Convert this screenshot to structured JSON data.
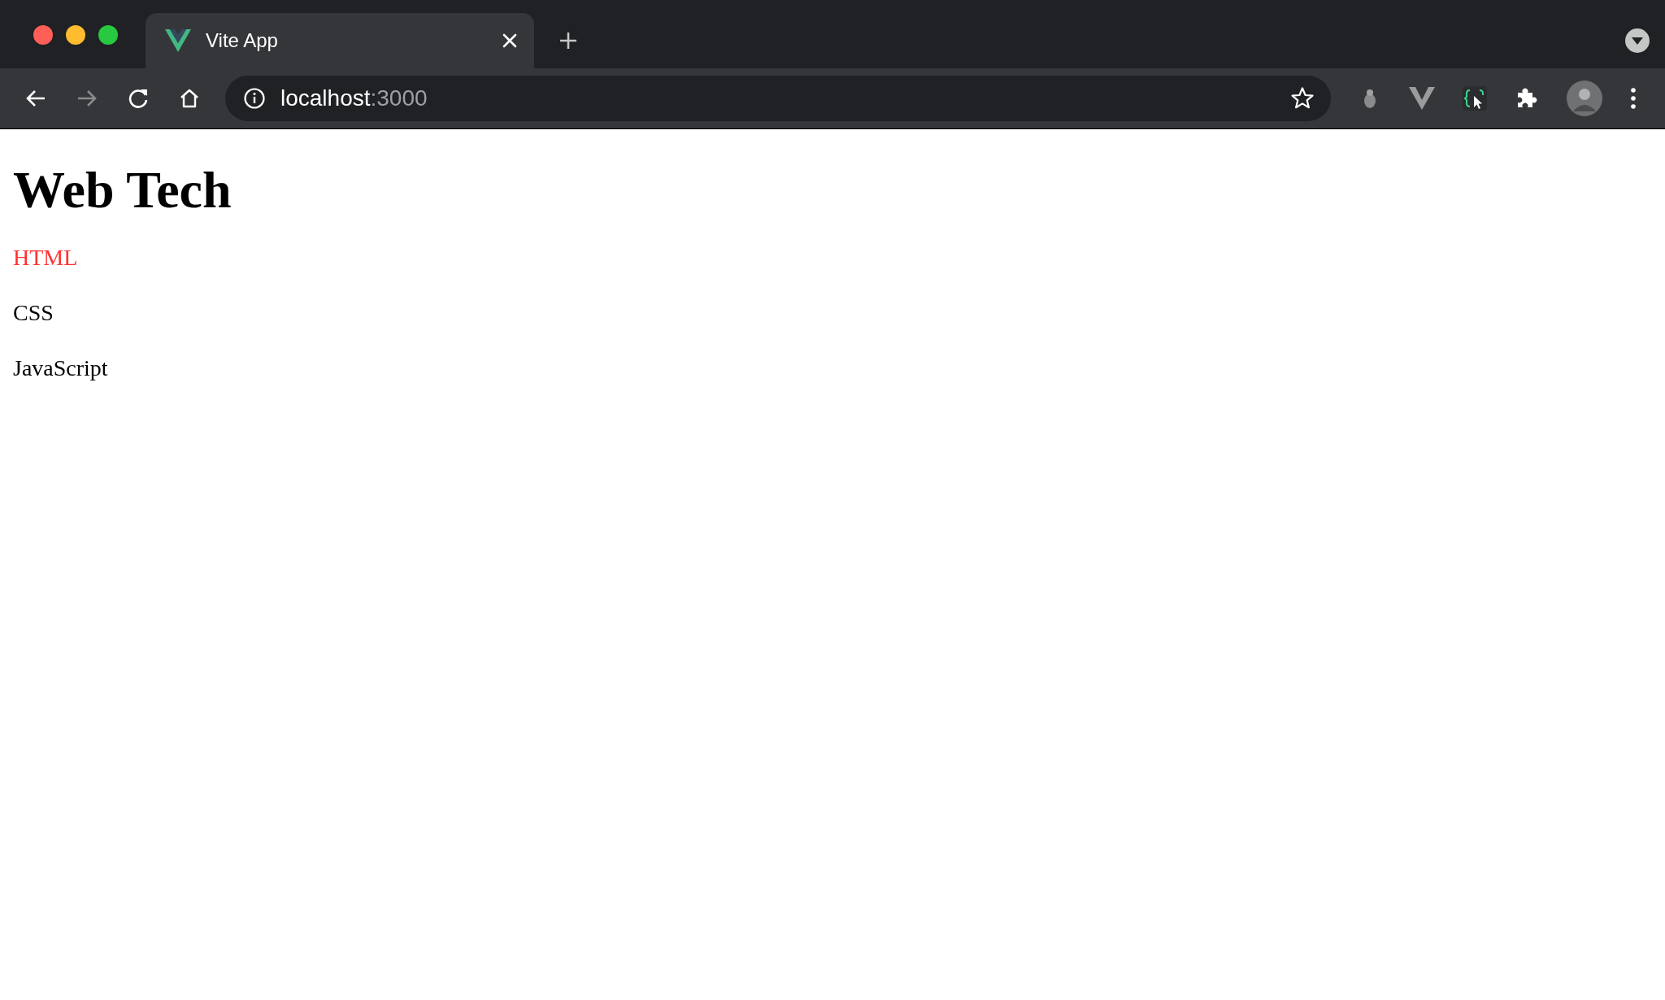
{
  "tab": {
    "title": "Vite App"
  },
  "address_bar": {
    "host": "localhost",
    "port": ":3000"
  },
  "page": {
    "heading": "Web Tech",
    "items": [
      {
        "label": "HTML",
        "color": "#ff3333"
      },
      {
        "label": "CSS",
        "color": "#000000"
      },
      {
        "label": "JavaScript",
        "color": "#000000"
      }
    ]
  }
}
